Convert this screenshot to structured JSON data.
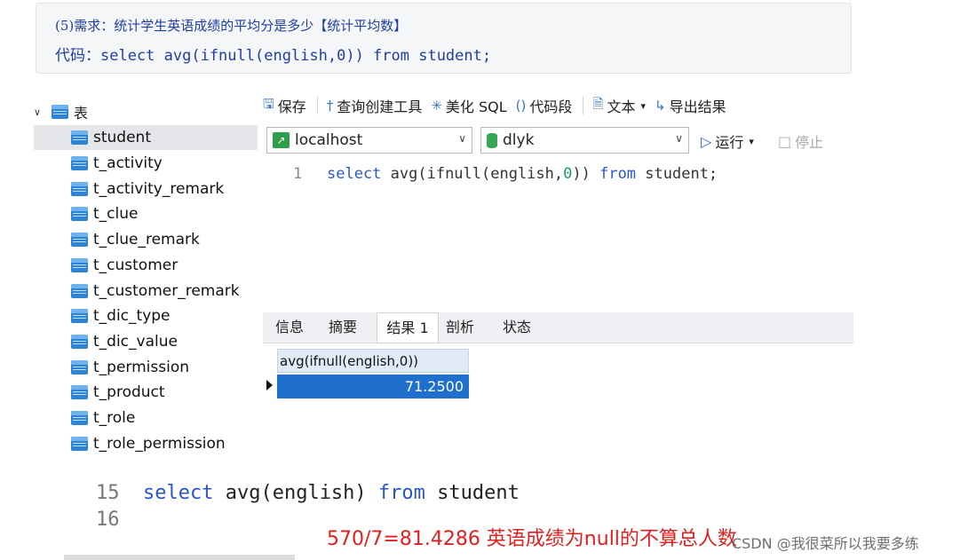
{
  "note": {
    "line1": "(5)需求：统计学生英语成绩的平均分是多少【统计平均数】",
    "line2": "代码：select avg(ifnull(english,0)) from student;"
  },
  "tree": {
    "root_label": "表",
    "items": [
      "student",
      "t_activity",
      "t_activity_remark",
      "t_clue",
      "t_clue_remark",
      "t_customer",
      "t_customer_remark",
      "t_dic_type",
      "t_dic_value",
      "t_permission",
      "t_product",
      "t_role",
      "t_role_permission"
    ]
  },
  "toolbar": {
    "save": "保存",
    "query_builder": "查询创建工具",
    "beautify": "美化 SQL",
    "snippet": "代码段",
    "text": "文本",
    "export": "导出结果"
  },
  "selectors": {
    "connection": "localhost",
    "database": "dlyk",
    "run": "运行",
    "stop": "停止"
  },
  "editor": {
    "line_number": "1",
    "kw_select": "select",
    "fn_open": " avg(ifnull(english,",
    "num": "0",
    "fn_close": ")) ",
    "kw_from": "from",
    "tail": " student;"
  },
  "result_tabs": [
    "信息",
    "摘要",
    "结果 1",
    "剖析",
    "状态"
  ],
  "grid": {
    "column": "avg(ifnull(english,0))",
    "value": "71.2500"
  },
  "bottom": {
    "l15_num": "15",
    "l15_kw1": "select",
    "l15_mid": " avg(english) ",
    "l15_kw2": "from",
    "l15_tail": " student",
    "l16_num": "16",
    "red_note": "570/7=81.4286   英语成绩为null的不算总人数",
    "watermark": "CSDN @我很菜所以我要多练"
  }
}
